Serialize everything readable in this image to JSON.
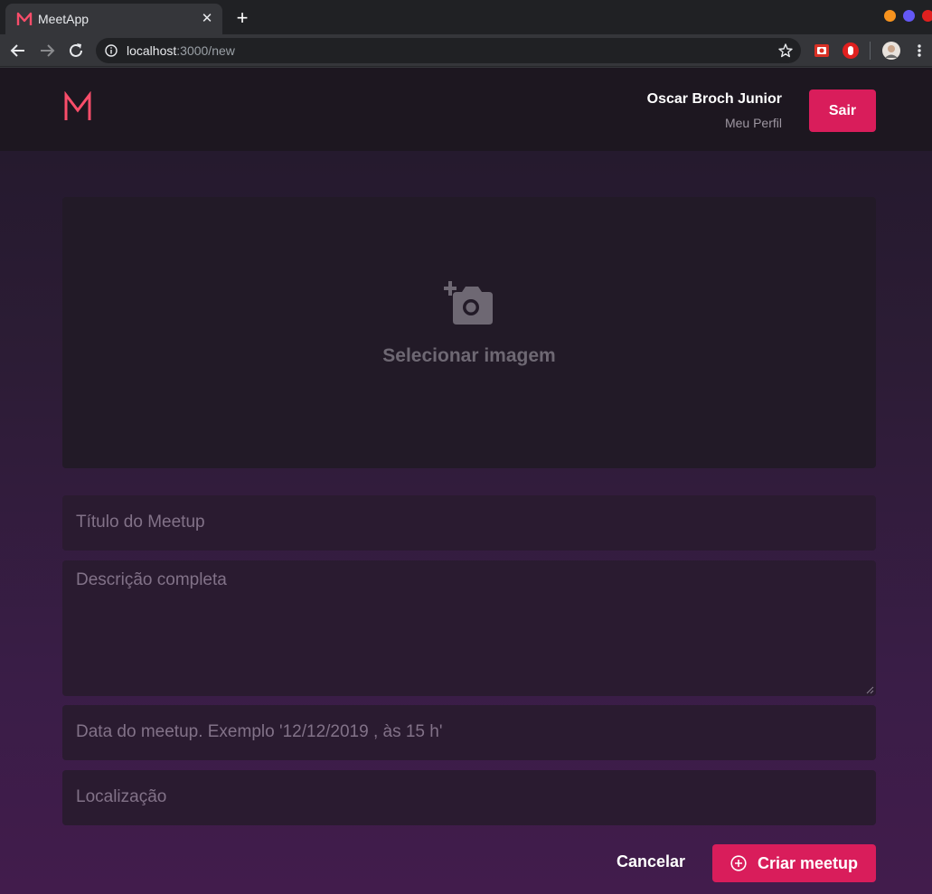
{
  "browser": {
    "tab_title": "MeetApp",
    "url_host": "localhost",
    "url_path": ":3000/new"
  },
  "header": {
    "logo_letter": "M",
    "user_name": "Oscar Broch Junior",
    "profile_link": "Meu Perfil",
    "logout_label": "Sair"
  },
  "form": {
    "image_label": "Selecionar imagem",
    "title_placeholder": "Título do Meetup",
    "description_placeholder": "Descrição completa",
    "date_placeholder": "Data do meetup. Exemplo '12/12/2019 , às 15 h'",
    "location_placeholder": "Localização",
    "cancel_label": "Cancelar",
    "submit_label": "Criar meetup"
  },
  "colors": {
    "accent": "#d91d5b",
    "header_bg": "#1d1720",
    "field_bg": "#2a1b30"
  }
}
